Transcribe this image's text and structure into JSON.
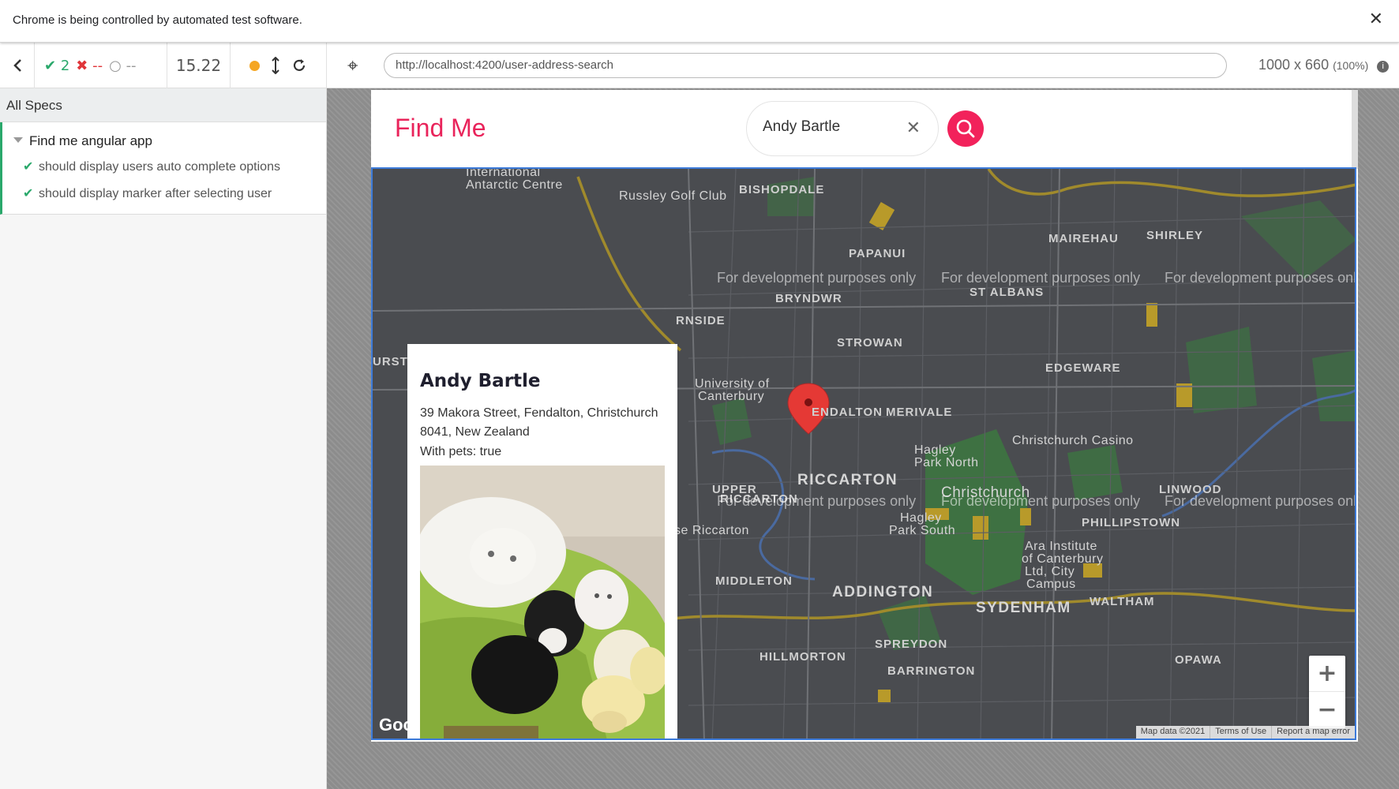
{
  "banner": {
    "text": "Chrome is being controlled by automated test software.",
    "close_icon": "close-icon"
  },
  "runner": {
    "passed_count": "2",
    "failed_count": "--",
    "pending_count": "--",
    "duration": "15.22",
    "url": "http://localhost:4200/user-address-search",
    "viewport_size": "1000 x 660",
    "viewport_scale": "(100%)"
  },
  "specs": {
    "header": "All Specs",
    "suite_title": "Find me angular app",
    "tests": [
      "should display users auto complete options",
      "should display marker after selecting user"
    ]
  },
  "app": {
    "brand": "Find Me",
    "search_value": "Andy Bartle"
  },
  "card": {
    "name": "Andy Bartle",
    "address": "39 Makora Street, Fendalton, Christchurch 8041, New Zealand",
    "pets": "With pets: true"
  },
  "map": {
    "watermark": "For development purposes only",
    "google_logo": "Goo",
    "attributions": [
      "Map data ©2021",
      "Terms of Use",
      "Report a map error"
    ],
    "zoom_in": "+",
    "zoom_out": "−",
    "labels": {
      "intl_antarctic_1": "International",
      "intl_antarctic_2": "Antarctic Centre",
      "russley": "Russley Golf Club",
      "bishopdale": "BISHOPDALE",
      "papanui": "PAPANUI",
      "mairehau": "MAIREHAU",
      "shirley": "SHIRLEY",
      "st_albans": "ST ALBANS",
      "bryndwr": "BRYNDWR",
      "rnside": "RNSIDE",
      "strowan": "STROWAN",
      "urst": "URST",
      "edgeware": "EDGEWARE",
      "uc_1": "University of",
      "uc_2": "Canterbury",
      "fendalton": "ENDALTON",
      "merivale": "MERIVALE",
      "casino": "Christchurch Casino",
      "hagley_north_1": "Hagley",
      "hagley_north_2": "Park North",
      "riccarton": "RICCARTON",
      "upper_1": "UPPER",
      "upper_2": "RICCARTON",
      "christchurch": "Christchurch",
      "linwood": "LINWOOD",
      "hagley_south_1": "Hagley",
      "hagley_south_2": "Park South",
      "se_riccarton": "se Riccarton",
      "phillipstown": "PHILLIPSTOWN",
      "ara_1": "Ara Institute",
      "ara_2": "of Canterbury",
      "ara_3": "Ltd, City",
      "ara_4": "Campus",
      "middleton": "MIDDLETON",
      "addington": "ADDINGTON",
      "sydenham": "SYDENHAM",
      "waltham": "WALTHAM",
      "spreydon": "SPREYDON",
      "hillmorton": "HILLMORTON",
      "opawa": "OPAWA",
      "barrington": "BARRINGTON"
    }
  },
  "colors": {
    "accent": "#e9245b",
    "pass": "#2aa86b",
    "fail": "#e0363a",
    "map_border": "#3d7bd9"
  }
}
